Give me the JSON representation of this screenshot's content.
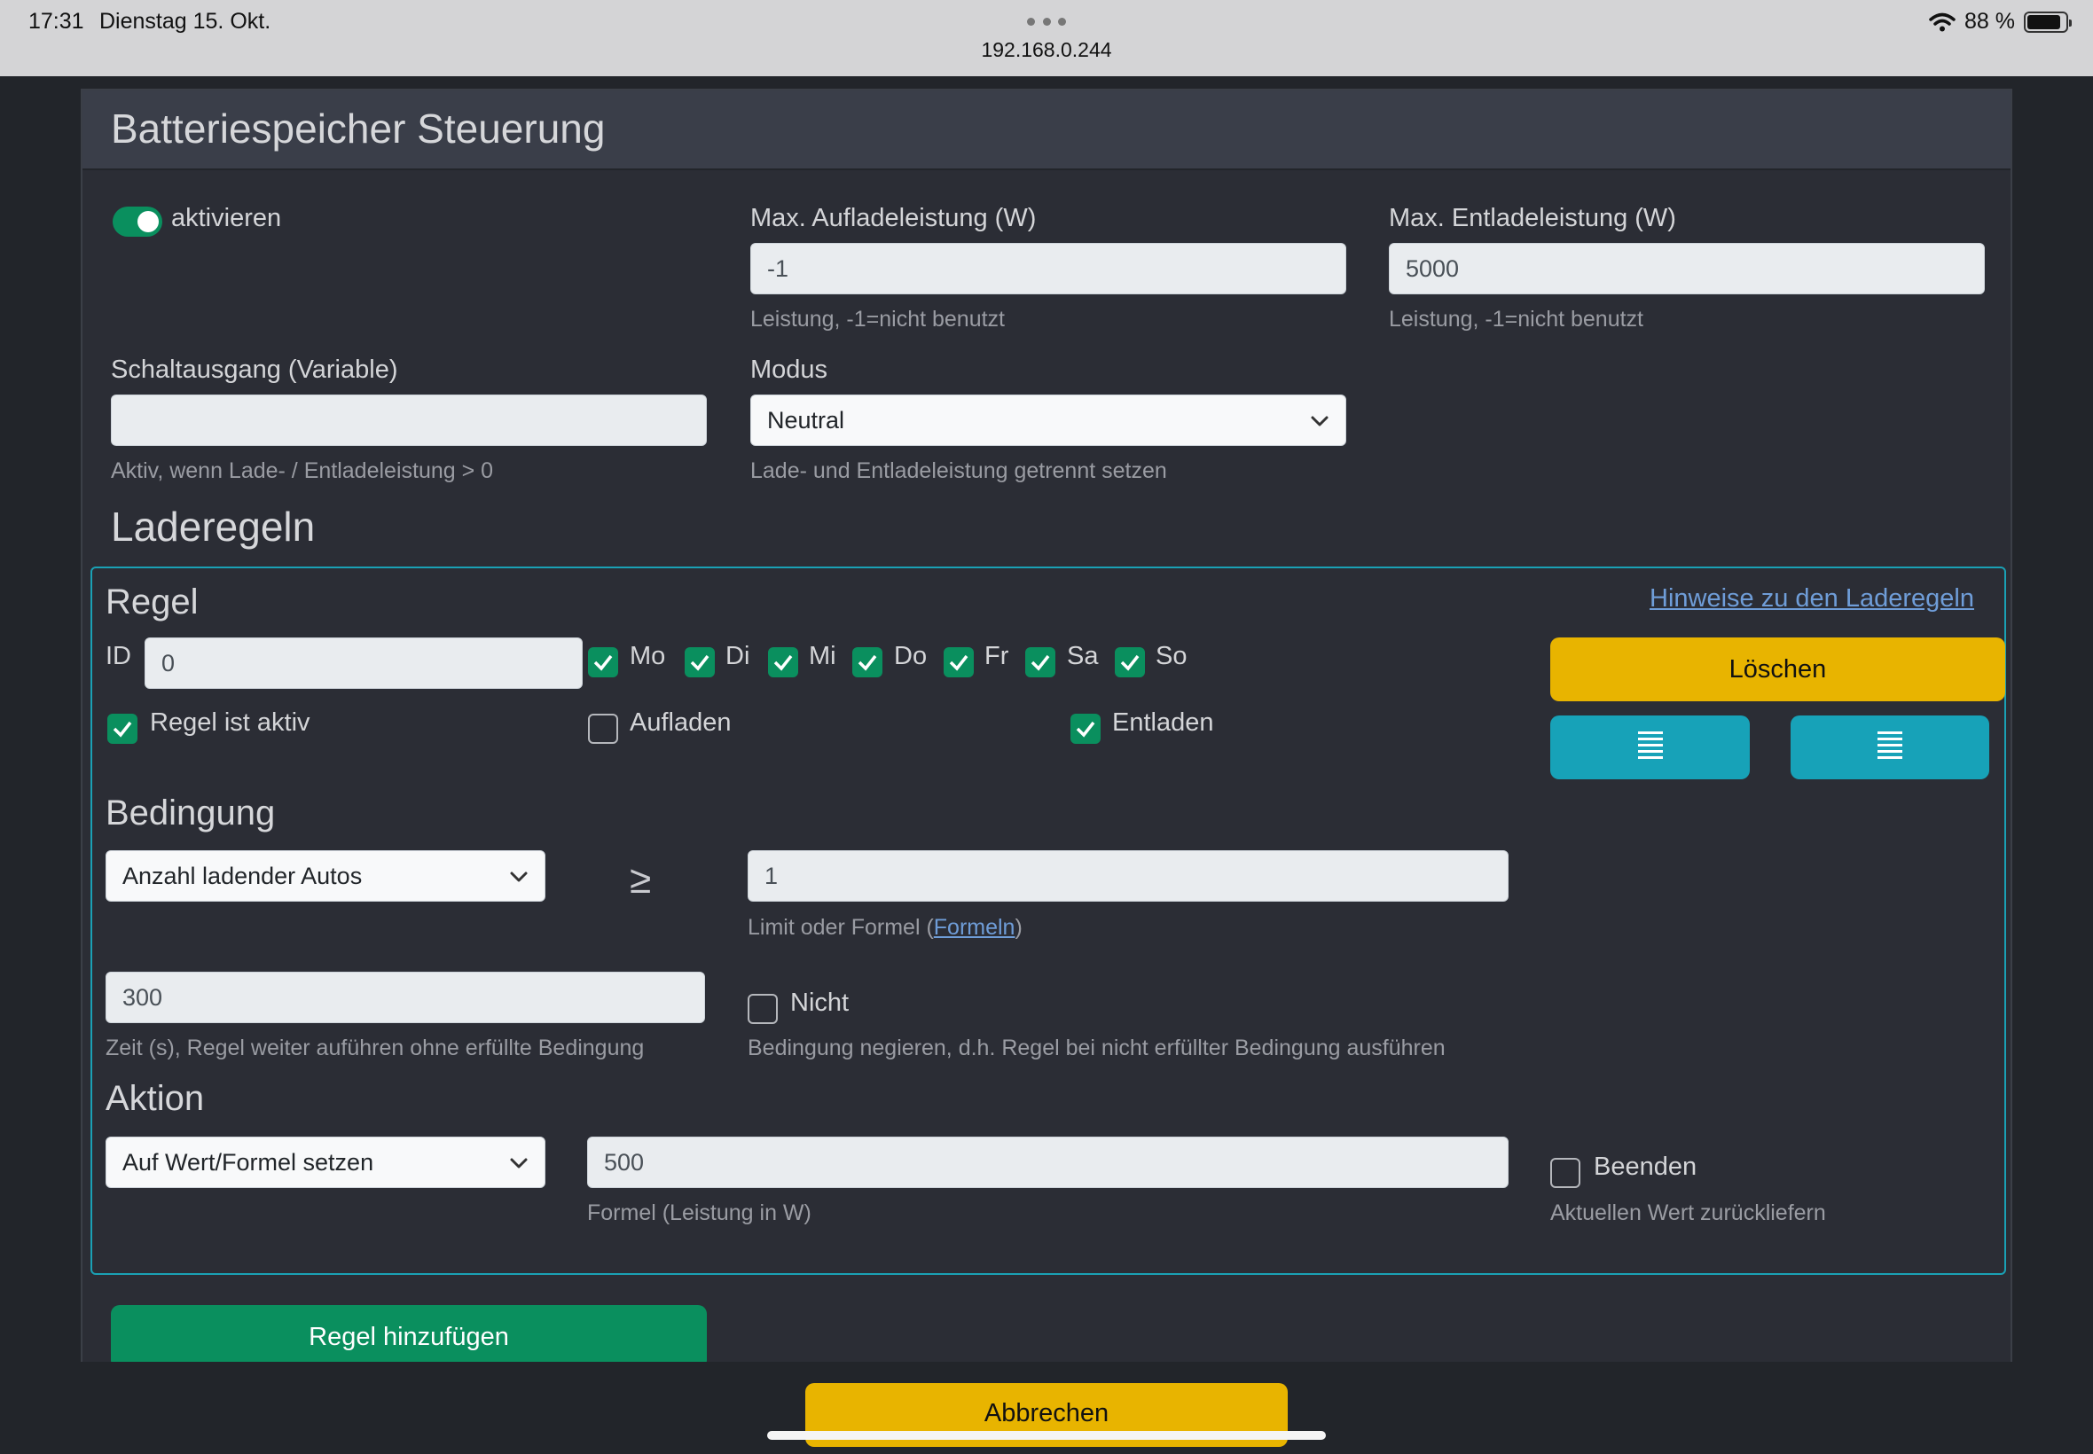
{
  "status_bar": {
    "time": "17:31",
    "date": "Dienstag 15. Okt.",
    "url": "192.168.0.244",
    "battery": "88 %"
  },
  "page": {
    "title": "Batteriespeicher Steuerung"
  },
  "settings": {
    "activate_label": "aktivieren",
    "max_charge_label": "Max. Aufladeleistung (W)",
    "max_charge_value": "-1",
    "max_charge_help": "Leistung, -1=nicht benutzt",
    "max_discharge_label": "Max. Entladeleistung (W)",
    "max_discharge_value": "5000",
    "max_discharge_help": "Leistung, -1=nicht benutzt",
    "switch_output_label": "Schaltausgang (Variable)",
    "switch_output_value": "",
    "switch_output_help": "Aktiv, wenn Lade- / Entladeleistung > 0",
    "mode_label": "Modus",
    "mode_value": "Neutral",
    "mode_help": "Lade- und Entladeleistung getrennt setzen"
  },
  "rules_title": "Laderegeln",
  "rule": {
    "title": "Regel",
    "hint_link": "Hinweise zu den Laderegeln",
    "id_label": "ID",
    "id_value": "0",
    "days": [
      "Mo",
      "Di",
      "Mi",
      "Do",
      "Fr",
      "Sa",
      "So"
    ],
    "active_label": "Regel ist aktiv",
    "charge_label": "Aufladen",
    "discharge_label": "Entladen",
    "delete_button": "Löschen",
    "condition_title": "Bedingung",
    "condition_select": "Anzahl ladender Autos",
    "operator": "≥",
    "limit_value": "1",
    "limit_help_prefix": "Limit oder Formel (",
    "limit_help_link": "Formeln",
    "limit_help_suffix": ")",
    "time_value": "300",
    "time_help": "Zeit (s), Regel weiter auführen ohne erfüllte Bedingung",
    "not_label": "Nicht",
    "not_help": "Bedingung negieren, d.h. Regel bei nicht erfüllter Bedingung ausführen",
    "action_title": "Aktion",
    "action_select": "Auf Wert/Formel setzen",
    "formula_value": "500",
    "formula_help": "Formel (Leistung in W)",
    "end_label": "Beenden",
    "end_help": "Aktuellen Wert zurückliefern"
  },
  "add_rule_button": "Regel hinzufügen",
  "cancel_button": "Abbrechen",
  "colors": {
    "green": "#0a8f5e",
    "yellow": "#e8b400",
    "teal": "#17a2b8",
    "link": "#6f9dd8"
  }
}
